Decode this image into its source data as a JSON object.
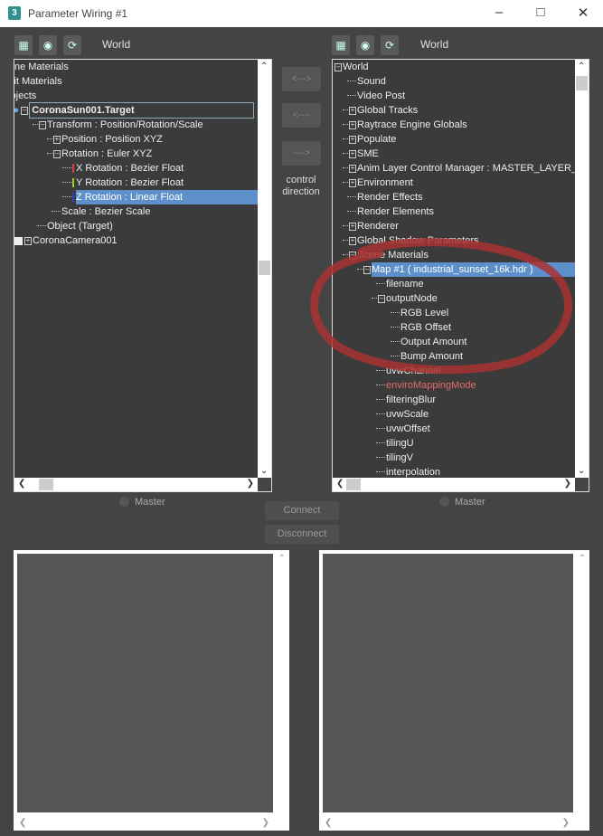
{
  "window": {
    "title": "Parameter Wiring #1",
    "app_icon_text": "3"
  },
  "left": {
    "world_label": "World",
    "tree": [
      {
        "label": "Scene Materials",
        "depth": 0,
        "exp": null,
        "shift": -7
      },
      {
        "label": "Medit Materials",
        "depth": 0,
        "exp": null,
        "shift": -10
      },
      {
        "label": "Objects",
        "depth": 0,
        "exp": null,
        "shift": -1
      },
      {
        "label": "CoronaSun001.Target",
        "depth": 2,
        "exp": "-",
        "state": "focused",
        "icon": "light-bulb"
      },
      {
        "label": "Transform : Position/Rotation/Scale",
        "depth": 3,
        "exp": "-"
      },
      {
        "label": "Position : Position XYZ",
        "depth": 4,
        "exp": "+"
      },
      {
        "label": "Rotation : Euler XYZ",
        "depth": 4,
        "exp": "-"
      },
      {
        "label": "X Rotation : Bezier Float",
        "depth": 5,
        "exp": null,
        "marker": "#e04040"
      },
      {
        "label": "Y Rotation : Bezier Float",
        "depth": 5,
        "exp": null,
        "marker": "#9acd32"
      },
      {
        "label": "Z Rotation : Linear Float",
        "depth": 5,
        "exp": null,
        "marker": "#3040d0",
        "state": "selected"
      },
      {
        "label": "Scale : Bezier Scale",
        "depth": 4,
        "exp": null
      },
      {
        "label": "Object (Target)",
        "depth": 3,
        "exp": null
      },
      {
        "label": "CoronaCamera001",
        "depth": 2,
        "exp": "+",
        "icon": "camera"
      }
    ],
    "master_label": "Master"
  },
  "right": {
    "world_label": "World",
    "tree": [
      {
        "label": "World",
        "depth": 0,
        "exp": "-"
      },
      {
        "label": "Sound",
        "depth": 1,
        "exp": null
      },
      {
        "label": "Video Post",
        "depth": 1,
        "exp": null
      },
      {
        "label": "Global Tracks",
        "depth": 1,
        "exp": "+"
      },
      {
        "label": "Raytrace Engine Globals",
        "depth": 1,
        "exp": "+"
      },
      {
        "label": "Populate",
        "depth": 1,
        "exp": "+"
      },
      {
        "label": "SME",
        "depth": 1,
        "exp": "+"
      },
      {
        "label": "Anim Layer Control Manager : MASTER_LAYER_MANAGER",
        "depth": 1,
        "exp": "+"
      },
      {
        "label": "Environment",
        "depth": 1,
        "exp": "+"
      },
      {
        "label": "Render Effects",
        "depth": 1,
        "exp": null
      },
      {
        "label": "Render Elements",
        "depth": 1,
        "exp": null
      },
      {
        "label": "Renderer",
        "depth": 1,
        "exp": "+"
      },
      {
        "label": "Global Shadow Parameters",
        "depth": 1,
        "exp": "+"
      },
      {
        "label": "Scene Materials",
        "depth": 1,
        "exp": "-"
      },
      {
        "label": "Map #1 ( industrial_sunset_16k.hdr )",
        "depth": 2,
        "exp": "-",
        "state": "selected"
      },
      {
        "label": "filename",
        "depth": 3,
        "exp": null
      },
      {
        "label": "outputNode",
        "depth": 3,
        "exp": "-"
      },
      {
        "label": "RGB Level",
        "depth": 4,
        "exp": null
      },
      {
        "label": "RGB Offset",
        "depth": 4,
        "exp": null
      },
      {
        "label": "Output Amount",
        "depth": 4,
        "exp": null
      },
      {
        "label": "Bump Amount",
        "depth": 4,
        "exp": null
      },
      {
        "label": "uvwChannel",
        "depth": 3,
        "exp": null
      },
      {
        "label": "enviroMappingMode",
        "depth": 3,
        "exp": null,
        "color": "#e46a6a"
      },
      {
        "label": "filteringBlur",
        "depth": 3,
        "exp": null
      },
      {
        "label": "uvwScale",
        "depth": 3,
        "exp": null
      },
      {
        "label": "uvwOffset",
        "depth": 3,
        "exp": null
      },
      {
        "label": "tilingU",
        "depth": 3,
        "exp": null
      },
      {
        "label": "tilingV",
        "depth": 3,
        "exp": null
      },
      {
        "label": "interpolation",
        "depth": 3,
        "exp": null
      }
    ],
    "master_label": "Master"
  },
  "direction": {
    "both": "<--->",
    "left": "<----",
    "right": "---->",
    "caption_line1": "control",
    "caption_line2": "direction"
  },
  "actions": {
    "connect": "Connect",
    "disconnect": "Disconnect"
  },
  "colors": {
    "selection": "#5d8fcb",
    "annotation_circle": "#a83232",
    "background": "#444444"
  }
}
